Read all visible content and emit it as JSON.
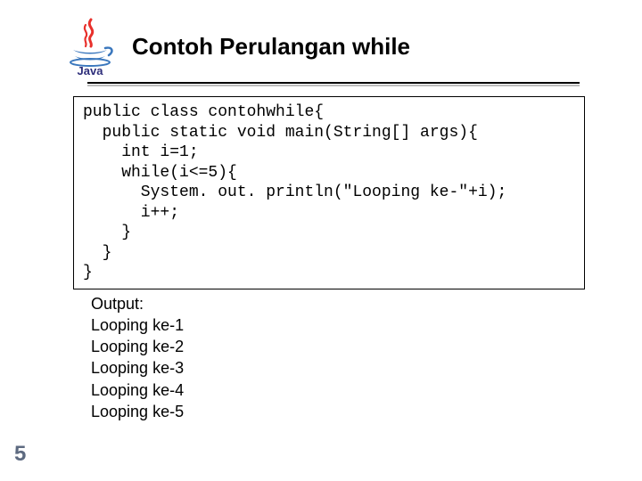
{
  "title": "Contoh Perulangan while",
  "code": {
    "l1": "public class contohwhile{",
    "l2": "  public static void main(String[] args){",
    "l3": "    int i=1;",
    "l4": "    while(i<=5){",
    "l5": "      System. out. println(\"Looping ke-\"+i);",
    "l6": "      i++;",
    "l7": "    }",
    "l8": "  }",
    "l9": "}"
  },
  "output": {
    "label": "Output:",
    "l1": "Looping ke-1",
    "l2": "Looping ke-2",
    "l3": "Looping ke-3",
    "l4": "Looping ke-4",
    "l5": "Looping ke-5"
  },
  "slide_number": "5",
  "logo_text": "Java"
}
